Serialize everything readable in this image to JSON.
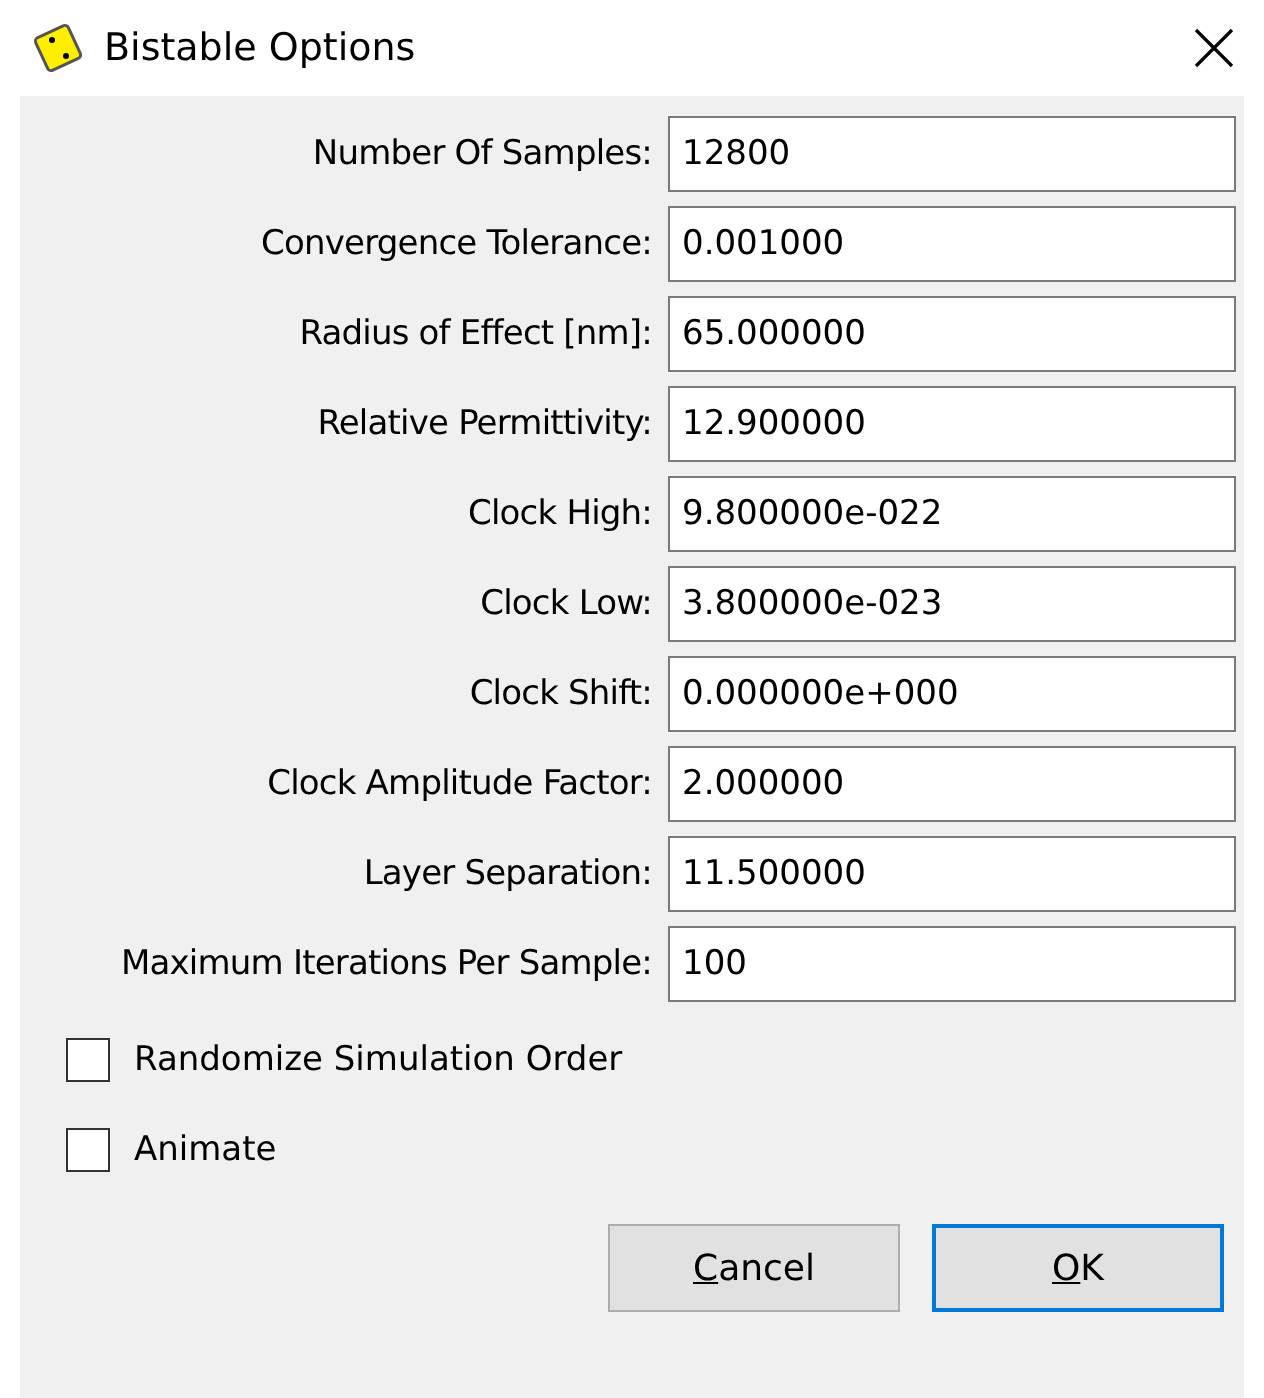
{
  "window": {
    "title": "Bistable Options"
  },
  "fields": [
    {
      "label": "Number Of Samples:",
      "value": "12800"
    },
    {
      "label": "Convergence Tolerance:",
      "value": "0.001000"
    },
    {
      "label": "Radius of Effect [nm]:",
      "value": "65.000000"
    },
    {
      "label": "Relative Permittivity:",
      "value": "12.900000"
    },
    {
      "label": "Clock High:",
      "value": "9.800000e-022"
    },
    {
      "label": "Clock Low:",
      "value": "3.800000e-023"
    },
    {
      "label": "Clock Shift:",
      "value": "0.000000e+000"
    },
    {
      "label": "Clock Amplitude Factor:",
      "value": "2.000000"
    },
    {
      "label": "Layer Separation:",
      "value": "11.500000"
    },
    {
      "label": "Maximum Iterations Per Sample:",
      "value": "100"
    }
  ],
  "checkboxes": [
    {
      "label": "Randomize Simulation Order",
      "checked": false
    },
    {
      "label": "Animate",
      "checked": false
    }
  ],
  "buttons": [
    {
      "label": "Cancel",
      "selected": false,
      "mnemonic_underlined": true
    },
    {
      "label": "OK",
      "selected": true,
      "mnemonic_underlined": true
    }
  ]
}
